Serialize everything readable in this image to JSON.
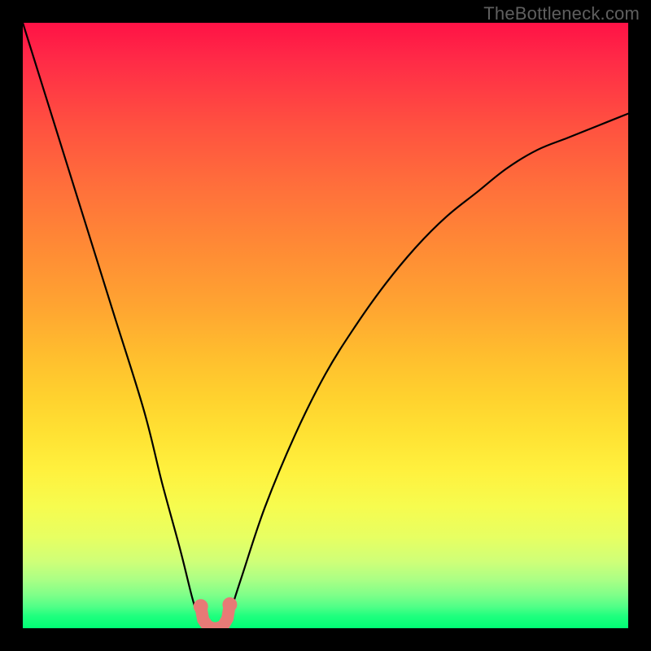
{
  "watermark": "TheBottleneck.com",
  "chart_data": {
    "type": "line",
    "title": "",
    "xlabel": "",
    "ylabel": "",
    "xlim": [
      0,
      100
    ],
    "ylim": [
      0,
      100
    ],
    "series": [
      {
        "name": "bottleneck-curve",
        "x": [
          0,
          5,
          10,
          15,
          20,
          23,
          26,
          28,
          29,
          30,
          31,
          32,
          33,
          34,
          36,
          40,
          45,
          50,
          55,
          60,
          65,
          70,
          75,
          80,
          85,
          90,
          95,
          100
        ],
        "values": [
          100,
          84,
          68,
          52,
          36,
          24,
          13,
          5,
          2,
          0.5,
          0,
          0,
          0.5,
          2,
          8,
          20,
          32,
          42,
          50,
          57,
          63,
          68,
          72,
          76,
          79,
          81,
          83,
          85
        ]
      }
    ],
    "markers": [
      {
        "name": "left-marker",
        "x": 29.4,
        "y": 3.6
      },
      {
        "name": "right-marker",
        "x": 34.2,
        "y": 3.9
      }
    ],
    "marker_stroke": {
      "x": [
        29.4,
        29.8,
        30.5,
        31.3,
        32.2,
        33.1,
        33.8,
        34.2
      ],
      "y": [
        3.6,
        1.4,
        0.4,
        0.0,
        0.0,
        0.4,
        1.6,
        3.9
      ]
    },
    "gradient_stops": [
      {
        "pos": 0,
        "color": "#ff1246"
      },
      {
        "pos": 50,
        "color": "#ffbe2e"
      },
      {
        "pos": 80,
        "color": "#f6fc4f"
      },
      {
        "pos": 100,
        "color": "#00ff75"
      }
    ]
  }
}
